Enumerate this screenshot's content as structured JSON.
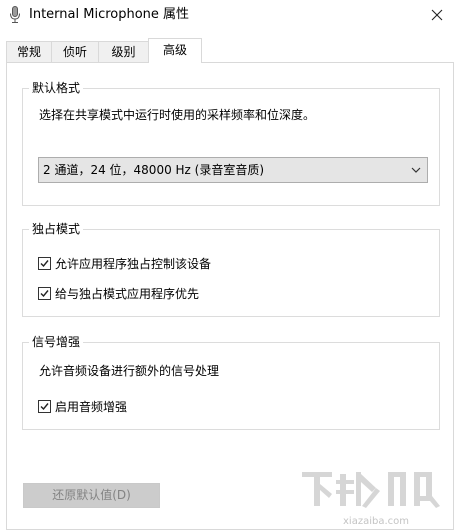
{
  "window": {
    "title": "Internal Microphone 属性",
    "close_glyph": "✕"
  },
  "tabs": [
    {
      "label": "常规",
      "active": false
    },
    {
      "label": "侦听",
      "active": false
    },
    {
      "label": "级别",
      "active": false
    },
    {
      "label": "高级",
      "active": true
    }
  ],
  "default_format": {
    "group_label": "默认格式",
    "description": "选择在共享模式中运行时使用的采样频率和位深度。",
    "selected_value": "2 通道，24 位，48000 Hz (录音室音质)"
  },
  "exclusive_mode": {
    "group_label": "独占模式",
    "options": [
      {
        "label": "允许应用程序独占控制该设备",
        "checked": true
      },
      {
        "label": "给与独占模式应用程序优先",
        "checked": true
      }
    ]
  },
  "signal_enhancement": {
    "group_label": "信号增强",
    "description": "允许音频设备进行额外的信号处理",
    "options": [
      {
        "label": "启用音频增强",
        "checked": true
      }
    ]
  },
  "footer": {
    "restore_button_label": "还原默认值(D)",
    "restore_button_enabled": false
  },
  "watermark": {
    "text": "xiazaiba.com"
  },
  "colors": {
    "panel_border": "#d9d9d9",
    "dropdown_bg": "#e5e5e5",
    "disabled_text": "#838383"
  }
}
